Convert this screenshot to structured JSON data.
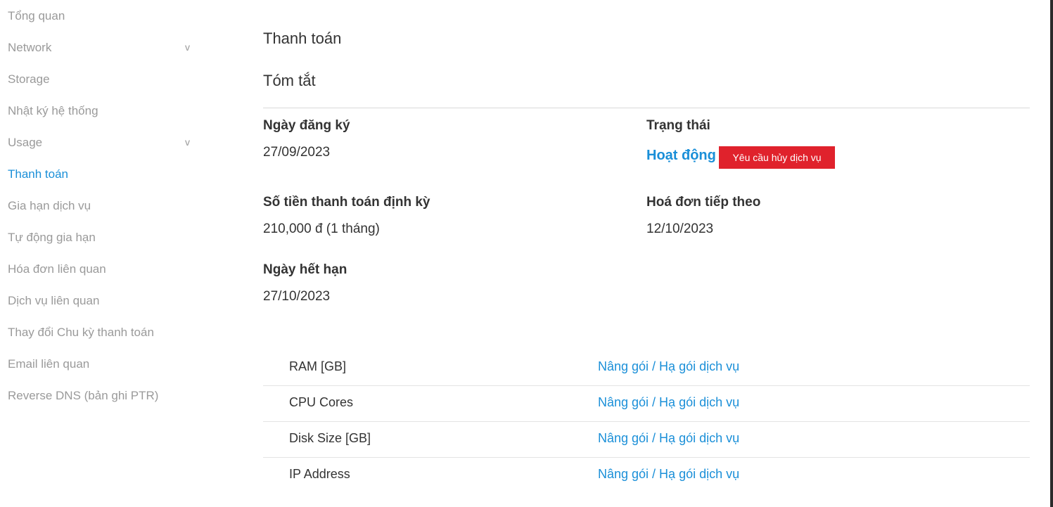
{
  "sidebar": {
    "items": [
      {
        "label": "Tổng quan"
      },
      {
        "label": "Network",
        "chevron": "v"
      },
      {
        "label": "Storage"
      },
      {
        "label": "Nhật ký hệ thống"
      },
      {
        "label": "Usage",
        "chevron": "v"
      },
      {
        "label": "Thanh toán",
        "active": true
      },
      {
        "label": "Gia hạn dịch vụ"
      },
      {
        "label": "Tự động gia hạn"
      },
      {
        "label": "Hóa đơn liên quan"
      },
      {
        "label": "Dịch vụ liên quan"
      },
      {
        "label": "Thay đổi Chu kỳ thanh toán"
      },
      {
        "label": "Email liên quan"
      },
      {
        "label": "Reverse DNS (bản ghi PTR)"
      }
    ]
  },
  "main": {
    "title": "Thanh toán",
    "subtitle": "Tóm tắt",
    "fields": {
      "signup_label": "Ngày đăng ký",
      "signup_value": "27/09/2023",
      "status_label": "Trạng thái",
      "status_value": "Hoạt động",
      "cancel_button": "Yêu cầu hủy dịch vụ",
      "recurring_label": "Số tiền thanh toán định kỳ",
      "recurring_value": "210,000 đ (1 tháng)",
      "next_invoice_label": "Hoá đơn tiếp theo",
      "next_invoice_value": "12/10/2023",
      "expiry_label": "Ngày hết hạn",
      "expiry_value": "27/10/2023"
    },
    "resources": [
      {
        "name": "RAM [GB]",
        "action": "Nâng gói / Hạ gói dịch vụ"
      },
      {
        "name": "CPU Cores",
        "action": "Nâng gói / Hạ gói dịch vụ"
      },
      {
        "name": "Disk Size [GB]",
        "action": "Nâng gói / Hạ gói dịch vụ"
      },
      {
        "name": "IP Address",
        "action": "Nâng gói / Hạ gói dịch vụ"
      }
    ]
  },
  "colors": {
    "accent": "#1a8fd8",
    "danger": "#e0222c",
    "muted_text": "#9a9a9a"
  }
}
